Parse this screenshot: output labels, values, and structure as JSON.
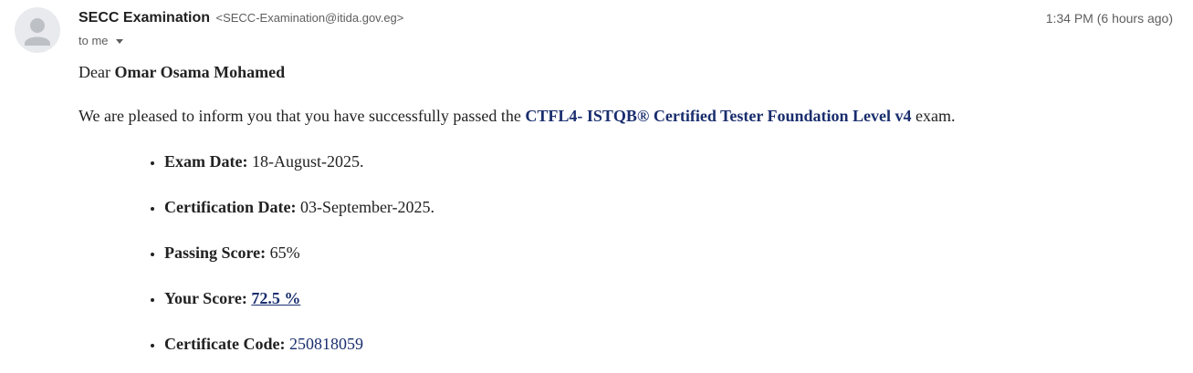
{
  "header": {
    "sender_name": "SECC Examination",
    "sender_email": "<SECC-Examination@itida.gov.eg>",
    "timestamp": "1:34 PM (6 hours ago)",
    "recipient_label": "to me",
    "avatar_icon": "person-icon",
    "caret_icon": "chevron-down-icon"
  },
  "body": {
    "greeting_prefix": "Dear ",
    "recipient_name": "Omar Osama Mohamed",
    "intro_prefix": "We are pleased to inform you that you have successfully passed the ",
    "exam_name": "CTFL4- ISTQB® Certified Tester Foundation Level v4",
    "intro_suffix": " exam.",
    "details": {
      "exam_date_label": "Exam Date:",
      "exam_date_value": "18-August-2025.",
      "cert_date_label": "Certification Date:",
      "cert_date_value": "03-September-2025.",
      "passing_score_label": "Passing Score:",
      "passing_score_value": "65%",
      "your_score_label": "Your Score:",
      "your_score_value": "72.5 %",
      "cert_code_label": "Certificate Code:",
      "cert_code_value": "250818059"
    }
  },
  "colors": {
    "accent_text": "#1a2e6e",
    "muted_text": "#5e5e5e",
    "avatar_bg": "#e8eaed"
  }
}
